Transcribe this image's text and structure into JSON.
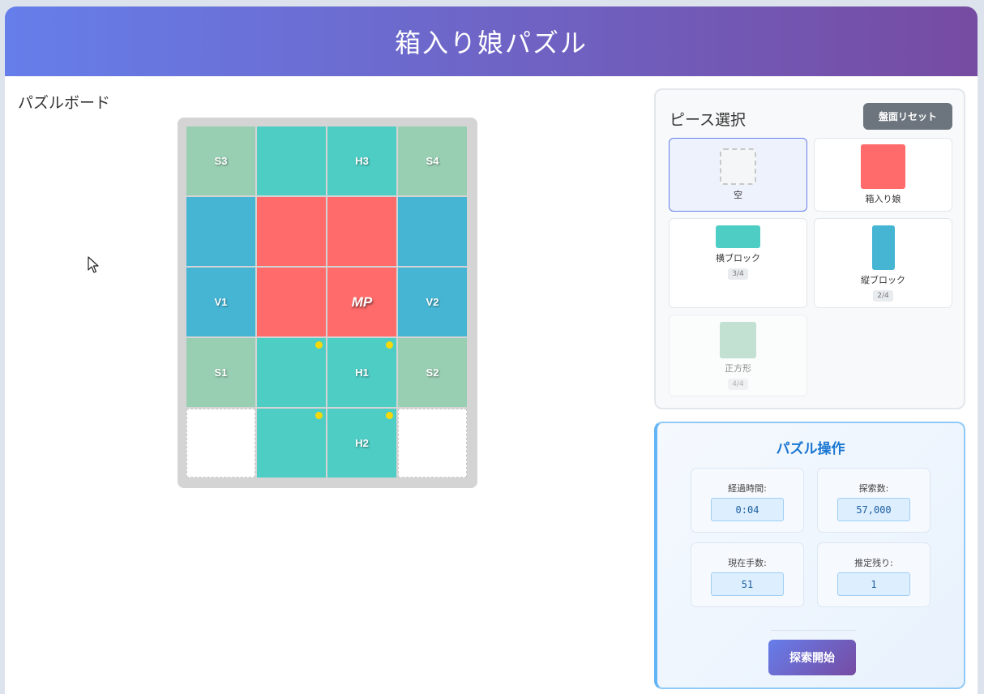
{
  "app": {
    "title": "箱入り娘パズル"
  },
  "board": {
    "title": "パズルボード",
    "cells": [
      {
        "label": "S3",
        "type": "square",
        "dot": false
      },
      {
        "label": "",
        "type": "horiz",
        "dot": false
      },
      {
        "label": "H3",
        "type": "horiz",
        "dot": false
      },
      {
        "label": "S4",
        "type": "square",
        "dot": false
      },
      {
        "label": "",
        "type": "vert",
        "dot": false
      },
      {
        "label": "",
        "type": "main",
        "dot": false
      },
      {
        "label": "",
        "type": "main",
        "dot": false
      },
      {
        "label": "",
        "type": "vert",
        "dot": false
      },
      {
        "label": "V1",
        "type": "vert",
        "dot": false
      },
      {
        "label": "",
        "type": "main",
        "dot": false
      },
      {
        "label": "MP",
        "type": "main",
        "dot": false
      },
      {
        "label": "V2",
        "type": "vert",
        "dot": false
      },
      {
        "label": "S1",
        "type": "square",
        "dot": false
      },
      {
        "label": "",
        "type": "horiz",
        "dot": true
      },
      {
        "label": "H1",
        "type": "horiz",
        "dot": true
      },
      {
        "label": "S2",
        "type": "square",
        "dot": false
      },
      {
        "label": "",
        "type": "empty",
        "dot": false
      },
      {
        "label": "",
        "type": "horiz",
        "dot": true
      },
      {
        "label": "H2",
        "type": "horiz",
        "dot": true
      },
      {
        "label": "",
        "type": "empty",
        "dot": false
      }
    ]
  },
  "pieces": {
    "title": "ピース選択",
    "reset_label": "盤面リセット",
    "items": [
      {
        "label": "空",
        "count": "",
        "selected": true
      },
      {
        "label": "箱入り娘",
        "count": ""
      },
      {
        "label": "横ブロック",
        "count": "3/4"
      },
      {
        "label": "縦ブロック",
        "count": "2/4"
      },
      {
        "label": "正方形",
        "count": "4/4",
        "disabled": true
      }
    ]
  },
  "ops": {
    "title": "パズル操作",
    "elapsed_label": "経過時間:",
    "elapsed_value": "0:04",
    "search_label": "探索数:",
    "search_value": "57,000",
    "moves_label": "現在手数:",
    "moves_value": "51",
    "remaining_label": "推定残り:",
    "remaining_value": "1",
    "start_label": "探索開始"
  },
  "colors": {
    "accent_start": "#667eea",
    "accent_end": "#764ba2",
    "main_piece": "#ff6b6b",
    "horiz_piece": "#4ecdc4",
    "vert_piece": "#45b5d3",
    "square_piece": "#98cfb2"
  }
}
